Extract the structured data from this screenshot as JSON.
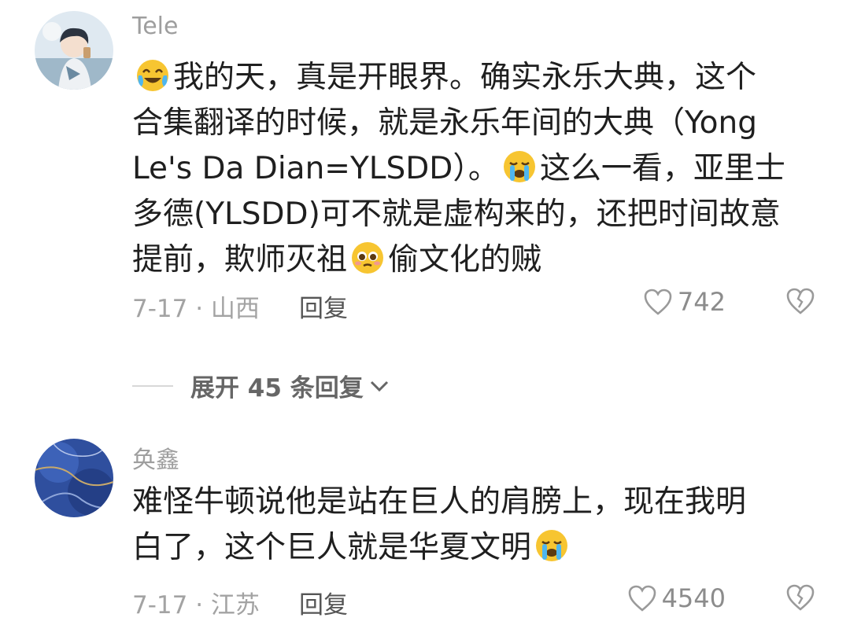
{
  "comments": [
    {
      "username": "Tele",
      "avatar_icon": "anime-boy-avatar",
      "lines": [
        {
          "parts": [
            "我的天，真是开眼界。确实永乐大典，这个"
          ],
          "emoji_before": "crying-laugh-emoji"
        },
        {
          "parts": [
            "合集翻译的时候，就是永乐年间的大典（Yong"
          ]
        },
        {
          "parts": [
            "Le's Da Dian=YLSDD）。",
            "这么一看，亚里士"
          ],
          "emoji_mid": "crying-emoji"
        },
        {
          "parts": [
            "多德(YLSDD)可不就是虚构来的，还把时间故意"
          ]
        },
        {
          "parts": [
            "提前，欺师灭祖",
            "偷文化的贼"
          ],
          "emoji_mid": "pleading-emoji"
        }
      ],
      "date": "7-17 · 山西",
      "reply_label": "回复",
      "likes": "742"
    },
    {
      "username": "奂鑫",
      "avatar_icon": "blue-marble-avatar",
      "lines": [
        {
          "parts": [
            "难怪牛顿说他是站在巨人的肩膀上，现在我明"
          ]
        },
        {
          "parts": [
            "白了，这个巨人就是华夏文明"
          ],
          "emoji_after": "crying-emoji"
        }
      ],
      "date": "7-17 · 江苏",
      "reply_label": "回复",
      "likes": "4540"
    }
  ],
  "expand_replies": "展开 45 条回复",
  "colors": {
    "meta_gray": "#a3a3a3",
    "text": "#1f1f1f",
    "username": "#9e9e9e"
  }
}
